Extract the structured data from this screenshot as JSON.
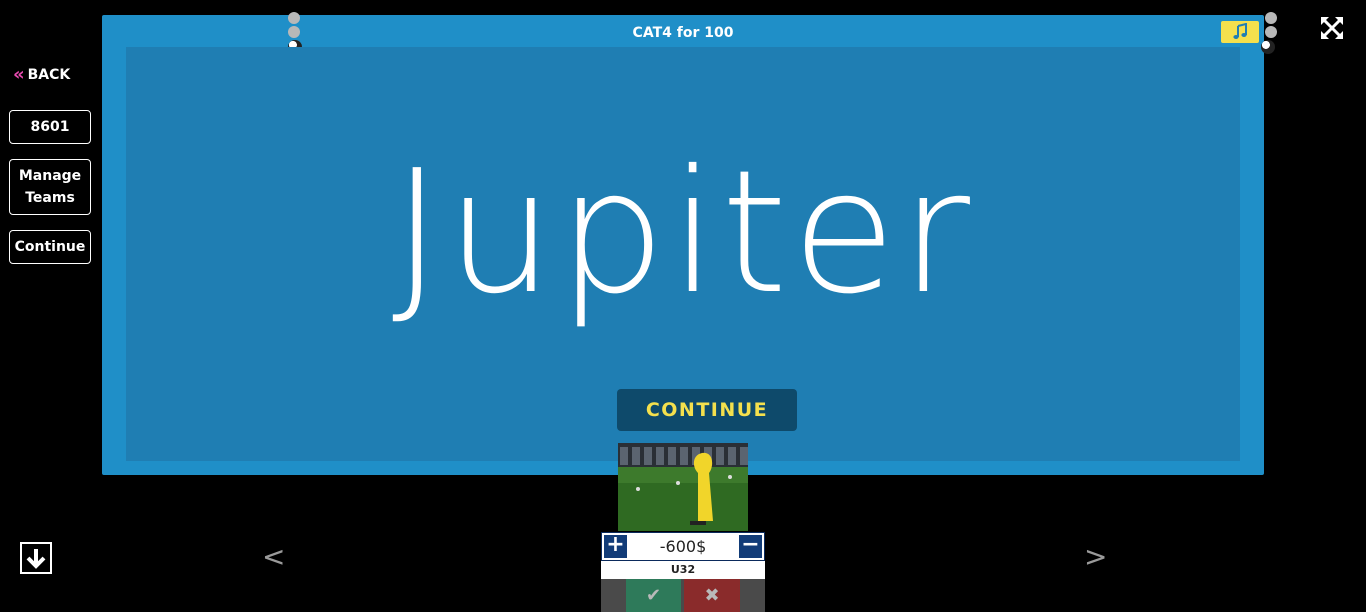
{
  "sidebar": {
    "back_label": "BACK",
    "code_label": "8601",
    "manage_label_line1": "Manage",
    "manage_label_line2": "Teams",
    "continue_label": "Continue"
  },
  "board": {
    "title": "CAT4 for 100",
    "answer": "Jupiter",
    "continue_label": "CONTINUE"
  },
  "icons": {
    "music": "music-note-icon",
    "fullscreen": "fullscreen-expand-icon",
    "down": "arrow-down-icon",
    "check": "check-icon",
    "close": "close-icon"
  },
  "nav": {
    "prev_label": "<",
    "next_label": ">"
  },
  "team": {
    "name": "U32",
    "score": "-600$",
    "plus_label": "+",
    "minus_label": "−"
  },
  "colors": {
    "board_outer": "#1f8fc8",
    "board_inner": "#1f7eb3",
    "continue_bg": "#0e4a6b",
    "continue_text": "#f4e04d",
    "music_bg": "#f4e04d",
    "back_chevron": "#e84bb0",
    "score_btn": "#123c78",
    "judge_ok": "#2e7a5a",
    "judge_no": "#8a2b2b"
  }
}
